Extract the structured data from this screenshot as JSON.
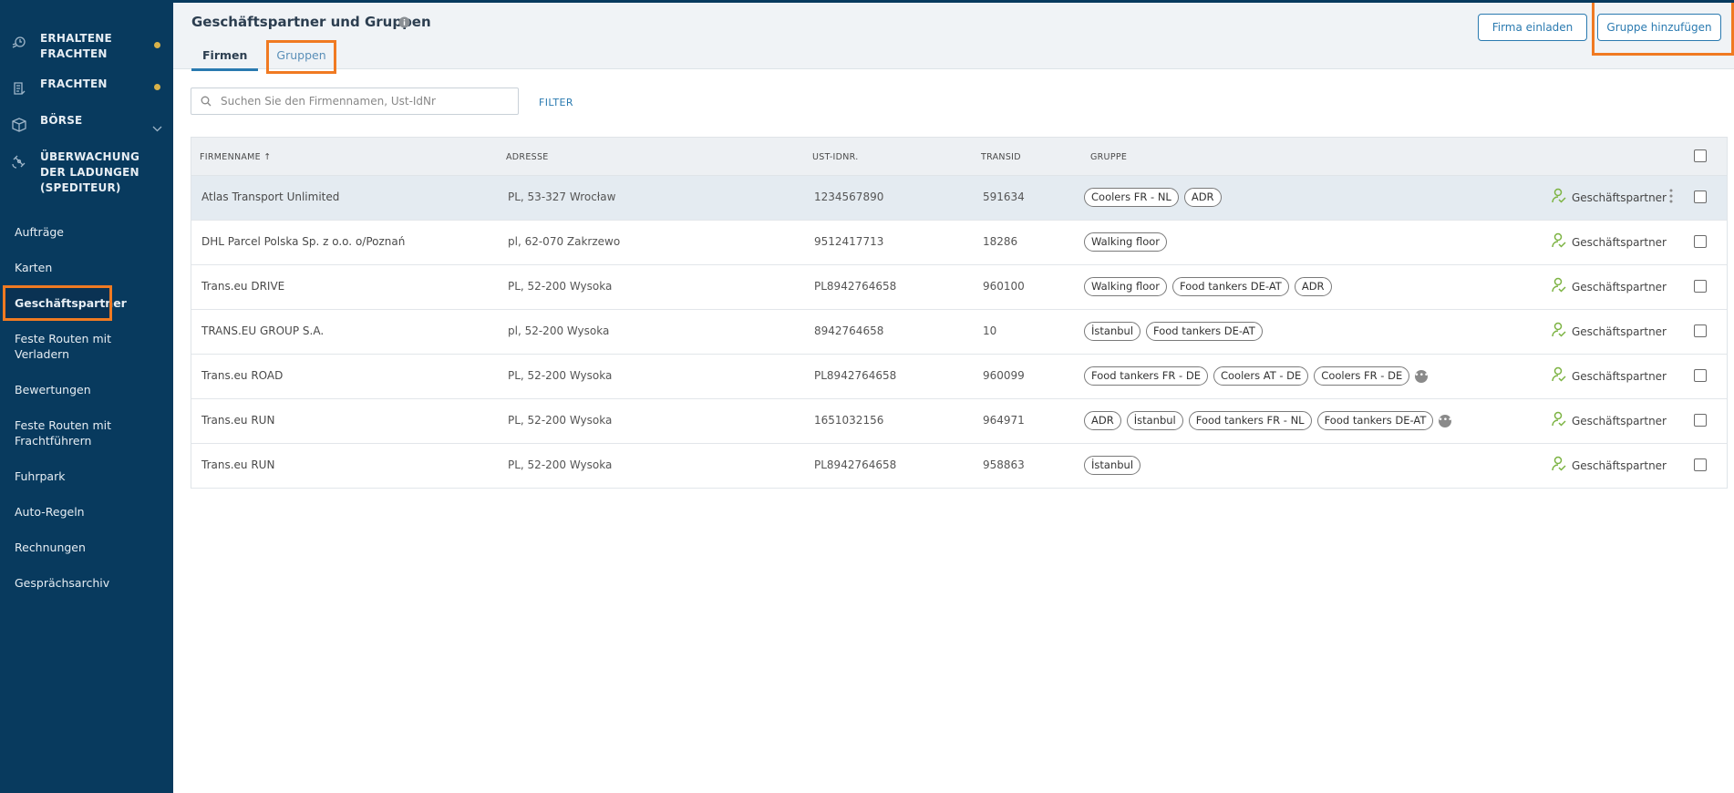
{
  "sidebar": {
    "top_items": [
      {
        "label": "ERHALTENE FRACHTEN",
        "icon": "received-freight-icon",
        "dot": true
      },
      {
        "label": "FRACHTEN",
        "icon": "freight-icon",
        "dot": true
      },
      {
        "label": "BÖRSE",
        "icon": "box-icon",
        "chevron": true
      },
      {
        "label": "ÜBERWACHUNG DER LADUNGEN (SPEDITEUR)",
        "icon": "satellite-icon"
      }
    ],
    "links": [
      {
        "label": "Aufträge"
      },
      {
        "label": "Karten"
      },
      {
        "label": "Geschäftspartner",
        "active": true
      },
      {
        "label": "Feste Routen mit Verladern"
      },
      {
        "label": "Bewertungen"
      },
      {
        "label": "Feste Routen mit Frachtführern"
      },
      {
        "label": "Fuhrpark"
      },
      {
        "label": "Auto-Regeln"
      },
      {
        "label": "Rechnungen"
      },
      {
        "label": "Gesprächsarchiv"
      }
    ],
    "dot_color": "#d8b24a"
  },
  "header": {
    "title": "Geschäftspartner und Gruppen",
    "tabs": [
      {
        "label": "Firmen",
        "active": true
      },
      {
        "label": "Gruppen",
        "active": false
      }
    ],
    "invite_button": "Firma einladen",
    "add_group_button": "Gruppe hinzufügen"
  },
  "search": {
    "placeholder": "Suchen Sie den Firmennamen, Ust-IdNr",
    "filter_label": "FILTER"
  },
  "table": {
    "columns": {
      "name": "FIRMENNAME ↑",
      "address": "ADRESSE",
      "vat": "UST-IDNR.",
      "transid": "TRANSID",
      "group": "GRUPPE"
    },
    "rows": [
      {
        "name": "Atlas Transport Unlimited",
        "address": "PL, 53-327 Wrocław",
        "vat": "1234567890",
        "transid": "591634",
        "groups": [
          "Coolers FR - NL",
          "ADR"
        ],
        "more": false,
        "partner": "Geschäftspartner",
        "selected": true
      },
      {
        "name": "DHL Parcel Polska Sp. z o.o. o/Poznań",
        "address": "pl, 62-070 Zakrzewo",
        "vat": "9512417713",
        "transid": "18286",
        "groups": [
          "Walking floor"
        ],
        "more": false,
        "partner": "Geschäftspartner"
      },
      {
        "name": "Trans.eu DRIVE",
        "address": "PL, 52-200 Wysoka",
        "vat": "PL8942764658",
        "transid": "960100",
        "groups": [
          "Walking floor",
          "Food tankers DE-AT",
          "ADR"
        ],
        "more": false,
        "partner": "Geschäftspartner"
      },
      {
        "name": "TRANS.EU GROUP S.A.",
        "address": "pl, 52-200 Wysoka",
        "vat": "8942764658",
        "transid": "10",
        "groups": [
          "İstanbul",
          "Food tankers DE-AT"
        ],
        "more": false,
        "partner": "Geschäftspartner"
      },
      {
        "name": "Trans.eu ROAD",
        "address": "PL, 52-200 Wysoka",
        "vat": "PL8942764658",
        "transid": "960099",
        "groups": [
          "Food tankers FR - DE",
          "Coolers AT - DE",
          "Coolers FR - DE"
        ],
        "more": true,
        "partner": "Geschäftspartner"
      },
      {
        "name": "Trans.eu RUN",
        "address": "PL, 52-200 Wysoka",
        "vat": "1651032156",
        "transid": "964971",
        "groups": [
          "ADR",
          "İstanbul",
          "Food tankers FR - NL",
          "Food tankers DE-AT"
        ],
        "more": true,
        "partner": "Geschäftspartner"
      },
      {
        "name": "Trans.eu RUN",
        "address": "PL, 52-200 Wysoka",
        "vat": "PL8942764658",
        "transid": "958863",
        "groups": [
          "İstanbul"
        ],
        "more": false,
        "partner": "Geschäftspartner"
      }
    ]
  },
  "colors": {
    "sidebar_bg": "#083a5e",
    "accent": "#2a7ab0",
    "highlight": "#f07a22",
    "partner_icon": "#7cb342"
  }
}
